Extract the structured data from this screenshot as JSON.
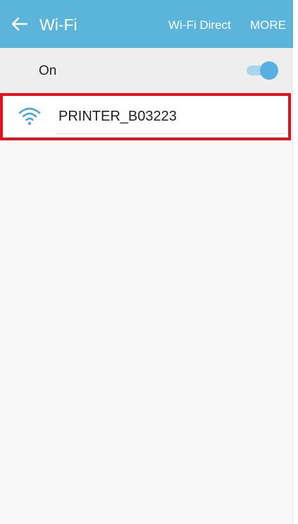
{
  "header": {
    "title": "Wi-Fi",
    "back_icon": "arrow-left-icon",
    "actions": [
      {
        "label": "Wi-Fi Direct"
      },
      {
        "label": "MORE"
      }
    ],
    "background_color": "#5bb4da"
  },
  "wifi_switch": {
    "label": "On",
    "state": "on",
    "accent_color": "#56b0e0"
  },
  "networks": [
    {
      "ssid": "PRINTER_B03223",
      "icon": "wifi-signal-icon",
      "highlight_color": "#e8101d"
    }
  ]
}
